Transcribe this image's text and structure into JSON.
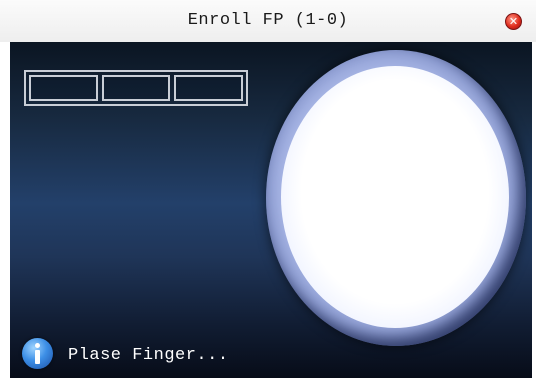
{
  "window": {
    "title": "Enroll FP (1-0)",
    "close_label": "✕"
  },
  "enrollment": {
    "slot_count": 3,
    "slots": [
      "",
      "",
      ""
    ]
  },
  "icons": {
    "close": "close-icon",
    "scanner": "fingerprint-scanner-lens",
    "info": "info-icon"
  },
  "status": {
    "message": "Plase Finger..."
  },
  "colors": {
    "title_bar": "#f4f4f4",
    "panel_top": "#0b1522",
    "panel_mid": "#23406a",
    "panel_bottom": "#070c18",
    "slot_border": "#c9ced6",
    "lens_glow": "#ffffff",
    "lens_rim": "#6476b6",
    "info_blue": "#3d8fe6",
    "close_red": "#e02d1d",
    "status_text": "#ffffff"
  }
}
